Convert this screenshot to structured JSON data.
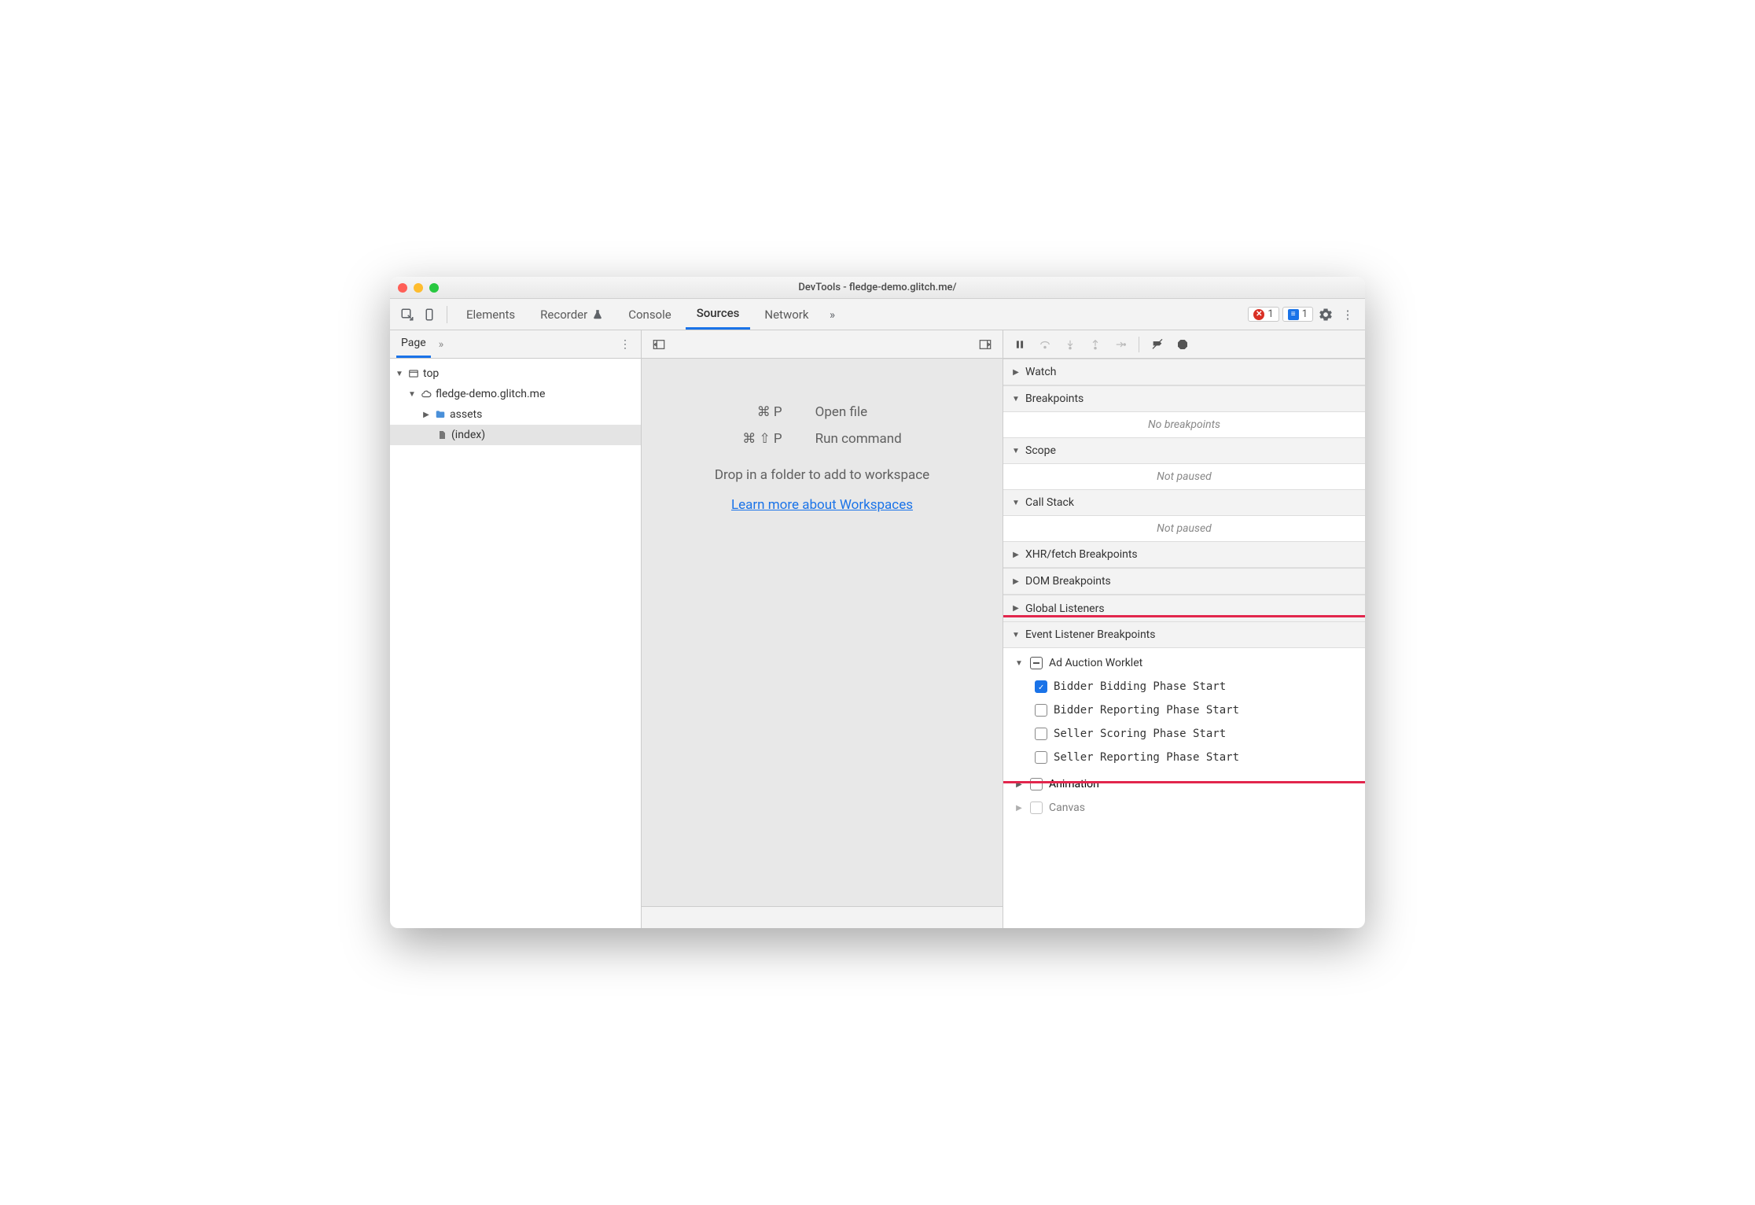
{
  "title": "DevTools - fledge-demo.glitch.me/",
  "topTabs": {
    "elements": "Elements",
    "recorder": "Recorder",
    "console": "Console",
    "sources": "Sources",
    "network": "Network"
  },
  "badges": {
    "errors": "1",
    "messages": "1"
  },
  "leftPanel": {
    "tab": "Page",
    "tree": {
      "top": "top",
      "origin": "fledge-demo.glitch.me",
      "assets": "assets",
      "index": "(index)"
    }
  },
  "mid": {
    "openFileKey": "⌘ P",
    "openFile": "Open file",
    "runCmdKey": "⌘ ⇧ P",
    "runCmd": "Run command",
    "dropHint": "Drop in a folder to add to workspace",
    "learnLink": "Learn more about Workspaces"
  },
  "right": {
    "watch": "Watch",
    "breakpoints": "Breakpoints",
    "noBreakpoints": "No breakpoints",
    "scope": "Scope",
    "notPaused1": "Not paused",
    "callStack": "Call Stack",
    "notPaused2": "Not paused",
    "xhr": "XHR/fetch Breakpoints",
    "dom": "DOM Breakpoints",
    "global": "Global Listeners",
    "elb": "Event Listener Breakpoints",
    "adAuction": "Ad Auction Worklet",
    "bp1": "Bidder Bidding Phase Start",
    "bp2": "Bidder Reporting Phase Start",
    "bp3": "Seller Scoring Phase Start",
    "bp4": "Seller Reporting Phase Start",
    "animation": "Animation",
    "canvas": "Canvas"
  }
}
